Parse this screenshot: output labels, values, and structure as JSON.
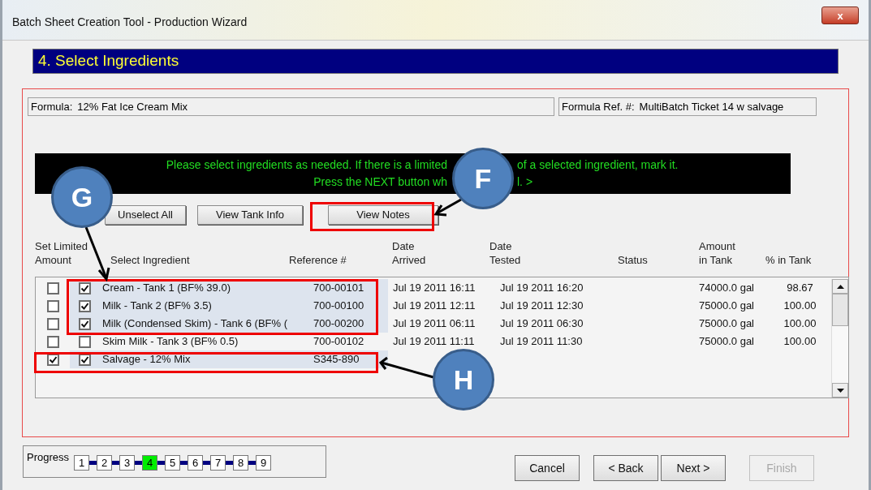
{
  "window": {
    "title": "Batch Sheet Creation Tool - Production Wizard",
    "close": "x"
  },
  "step_title": "4. Select Ingredients",
  "formula": {
    "label": "Formula:",
    "value": "12% Fat Ice Cream Mix"
  },
  "formula_ref": {
    "label": "Formula Ref. #:",
    "value": "MultiBatch Ticket 14 w salvage"
  },
  "banner": {
    "lines": [
      [
        "Please select ingredients as needed. If there is a limited",
        "of a selected ingredient, mark it."
      ],
      [
        "Press the NEXT button wh",
        "l. >"
      ]
    ]
  },
  "buttons": [
    "Unselect All",
    "View Tank Info",
    "View Notes"
  ],
  "columns": [
    "Set Limited\nAmount",
    "Select Ingredient",
    "Reference #",
    "Date\nArrived",
    "Date\nTested",
    "Status",
    "Amount\nin Tank",
    "% in Tank"
  ],
  "rows": [
    {
      "limited": false,
      "selected": true,
      "ingredient": "Cream - Tank 1  (BF% 39.0)",
      "reference": "700-00101",
      "arrived": "Jul 19 2011 16:11",
      "tested": "Jul 19 2011 16:20",
      "amount": "74000.0 gal",
      "percent": "98.67"
    },
    {
      "limited": false,
      "selected": true,
      "ingredient": "Milk - Tank 2  (BF% 3.5)",
      "reference": "700-00100",
      "arrived": "Jul 19 2011 12:11",
      "tested": "Jul 19 2011 12:30",
      "amount": "75000.0 gal",
      "percent": "100.00"
    },
    {
      "limited": false,
      "selected": true,
      "ingredient": "Milk (Condensed Skim) - Tank 6  (BF% (",
      "reference": "700-00200",
      "arrived": "Jul 19 2011 06:11",
      "tested": "Jul 19 2011 06:30",
      "amount": "75000.0 gal",
      "percent": "100.00"
    },
    {
      "limited": false,
      "selected": false,
      "ingredient": "Skim Milk - Tank 3  (BF% 0.5)",
      "reference": "700-00102",
      "arrived": "Jul 19 2011 11:11",
      "tested": "Jul 19 2011 11:30",
      "amount": "75000.0 gal",
      "percent": "100.00"
    },
    {
      "limited": true,
      "selected": true,
      "ingredient": "Salvage - 12% Mix",
      "reference": "S345-890"
    }
  ],
  "progress": {
    "label": "Progress",
    "steps": [
      {
        "label": "1",
        "selected": false
      },
      {
        "label": "2",
        "selected": false
      },
      {
        "label": "3",
        "selected": false
      },
      {
        "label": "4",
        "selected": true
      },
      {
        "label": "5",
        "selected": false
      },
      {
        "label": "6",
        "selected": false
      },
      {
        "label": "7",
        "selected": false
      },
      {
        "label": "8",
        "selected": false
      },
      {
        "label": "9",
        "selected": false
      }
    ]
  },
  "nav_buttons": [
    {
      "label": "Cancel",
      "disabled": false
    },
    {
      "label": "< Back",
      "disabled": false
    },
    {
      "label": "Next >",
      "disabled": false
    },
    {
      "label": "Finish",
      "disabled": true
    }
  ],
  "callouts": [
    {
      "label": "G"
    },
    {
      "label": "F"
    },
    {
      "label": "H"
    }
  ]
}
